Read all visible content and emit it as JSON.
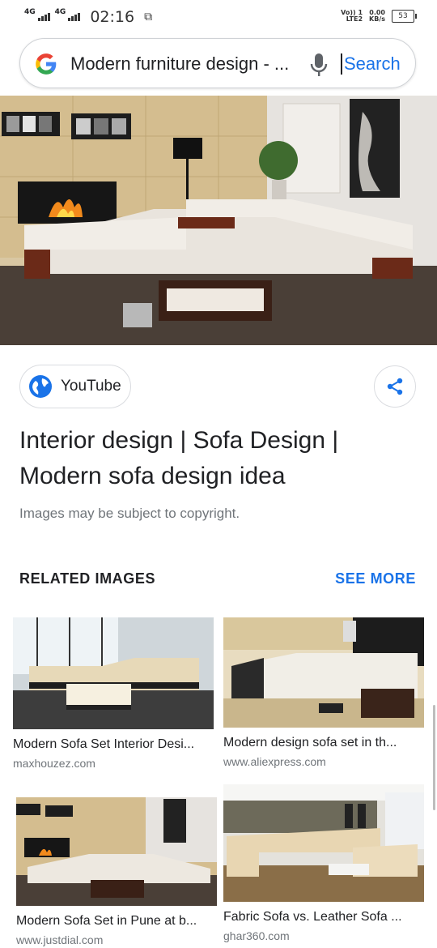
{
  "status_bar": {
    "network_1": "4G",
    "network_2": "4G",
    "time": "02:16",
    "volte_line1": "Vo)) 1",
    "volte_line2": "LTE2",
    "speed_value": "0.00",
    "speed_unit": "KB/s",
    "battery_level": "53"
  },
  "search": {
    "query": "Modern furniture design - ...",
    "button_label": "Search",
    "icons": [
      "google-g-icon",
      "mic-icon"
    ]
  },
  "result": {
    "source_label": "YouTube",
    "title": "Interior design | Sofa Design | Modern sofa design idea",
    "copyright_note": "Images may be subject to copyright."
  },
  "related": {
    "heading": "RELATED IMAGES",
    "see_more_label": "SEE MORE",
    "items": [
      {
        "title": "Modern Sofa Set Interior Desi...",
        "site": "maxhouzez.com"
      },
      {
        "title": "Modern design sofa set in th...",
        "site": "www.aliexpress.com"
      },
      {
        "title": "Modern Sofa Set in Pune at b...",
        "site": "www.justdial.com"
      },
      {
        "title": "Fabric Sofa vs. Leather Sofa ...",
        "site": "ghar360.com"
      }
    ]
  },
  "colors": {
    "accent": "#1a73e8",
    "text": "#202124",
    "muted": "#70757a",
    "border": "#dadce0"
  }
}
